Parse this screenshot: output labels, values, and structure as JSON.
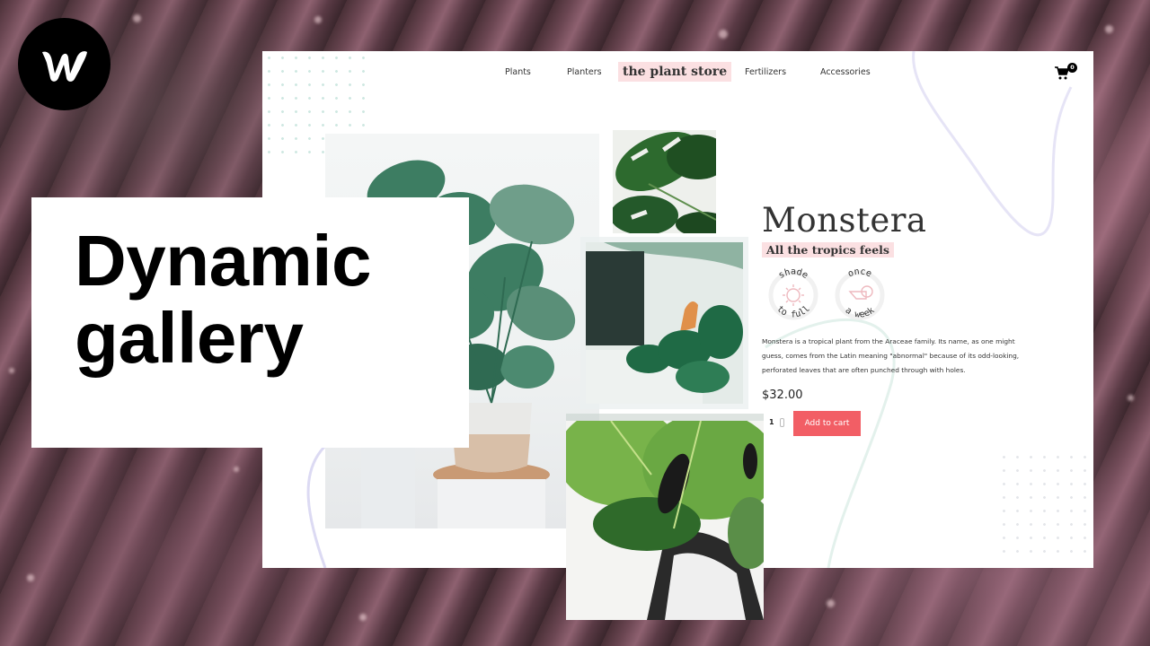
{
  "overlay": {
    "title_line1": "Dynamic",
    "title_line2": "gallery",
    "logo_letter": "W",
    "logo_icon": "webflow-logo-icon"
  },
  "site": {
    "nav": {
      "items": [
        "Plants",
        "Planters",
        "Fertilizers",
        "Accessories"
      ],
      "brand": "the plant store",
      "cart_count": "0",
      "cart_icon": "cart-icon"
    },
    "gallery": {
      "images": [
        {
          "name": "monstera-potted-main",
          "alt": "Potted monstera on a wooden stool"
        },
        {
          "name": "monstera-leaves-closeup",
          "alt": "Dark green monstera leaves"
        },
        {
          "name": "living-room-plants",
          "alt": "Plants in front of a TV with a flamingo figure"
        },
        {
          "name": "monstera-leaves-shoes",
          "alt": "Bright monstera leaves over sneakers"
        }
      ]
    },
    "product": {
      "title": "Monstera",
      "tagline": "All the tropics feels",
      "badges": [
        {
          "top": "shade",
          "bottom": "to full",
          "icon": "sun-icon"
        },
        {
          "top": "once",
          "bottom": "a week",
          "icon": "watering-can-icon"
        }
      ],
      "description": "Monstera is a tropical plant from the Araceae family. Its name, as one might guess, comes from the Latin meaning \"abnormal\" because of its odd-looking, perforated leaves that are often punched through with holes.",
      "price": "$32.00",
      "quantity": "1",
      "add_to_cart": "Add to cart"
    },
    "colors": {
      "accent_pink": "#fbe0e2",
      "button_red": "#f25e65",
      "dot_teal": "#cfe8e2",
      "curve_lavender": "#e4e2f5"
    }
  }
}
